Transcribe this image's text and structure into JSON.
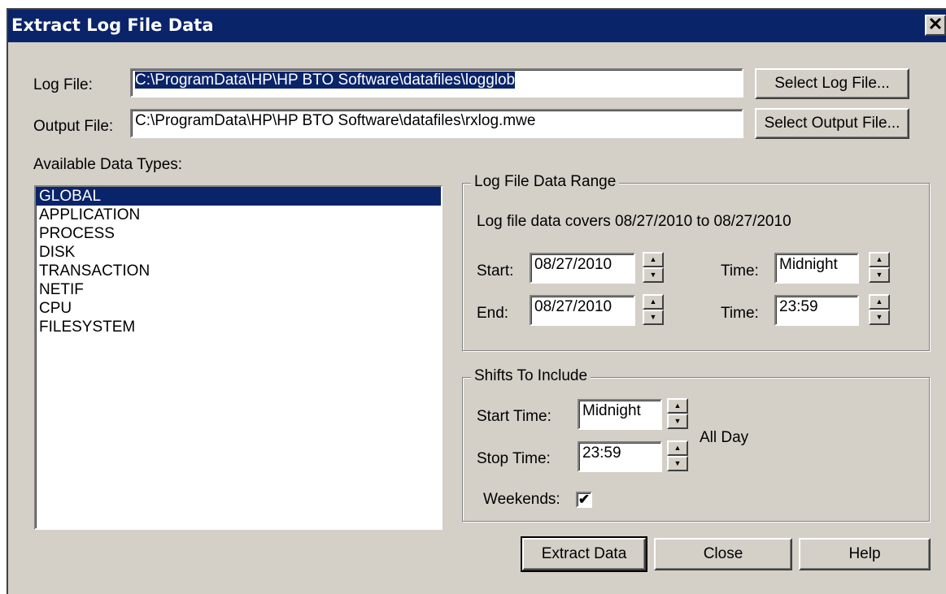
{
  "window": {
    "title": "Extract Log File Data",
    "close_glyph": "✕"
  },
  "log_file": {
    "label": "Log File:",
    "value": "C:\\ProgramData\\HP\\HP BTO Software\\datafiles\\logglob",
    "button": "Select Log File..."
  },
  "output_file": {
    "label": "Output File:",
    "value": "C:\\ProgramData\\HP\\HP BTO Software\\datafiles\\rxlog.mwe",
    "button": "Select Output File..."
  },
  "data_types": {
    "label": "Available Data Types:",
    "items": [
      "GLOBAL",
      "APPLICATION",
      "PROCESS",
      "DISK",
      "TRANSACTION",
      "NETIF",
      "CPU",
      "FILESYSTEM"
    ],
    "selected": "GLOBAL"
  },
  "range": {
    "legend": "Log File Data Range",
    "covers": "Log file data covers 08/27/2010 to 08/27/2010",
    "start_label": "Start:",
    "start_date": "08/27/2010",
    "start_time_label": "Time:",
    "start_time": "Midnight",
    "end_label": "End:",
    "end_date": "08/27/2010",
    "end_time_label": "Time:",
    "end_time": "23:59"
  },
  "shifts": {
    "legend": "Shifts To Include",
    "start_label": "Start Time:",
    "start_value": "Midnight",
    "stop_label": "Stop Time:",
    "stop_value": "23:59",
    "all_day": "All Day",
    "weekends_label": "Weekends:",
    "weekends_checked": true,
    "check_glyph": "✔"
  },
  "buttons": {
    "extract": "Extract Data",
    "close": "Close",
    "help": "Help"
  },
  "colors": {
    "face": "#d4d0c8",
    "title_bg": "#0a246a",
    "selection": "#0a246a"
  },
  "icons": {
    "spin_up": "▲",
    "spin_down": "▼"
  }
}
